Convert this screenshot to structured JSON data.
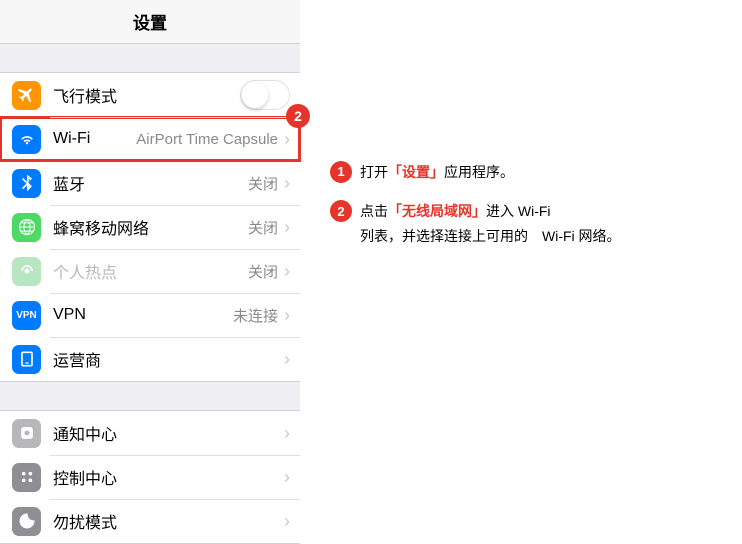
{
  "title": "设置",
  "rows": {
    "airplane": {
      "label": "飞行模式"
    },
    "wifi": {
      "label": "Wi-Fi",
      "value": "AirPort Time Capsule"
    },
    "bluetooth": {
      "label": "蓝牙",
      "value": "关闭"
    },
    "cellular": {
      "label": "蜂窝移动网络",
      "value": "关闭"
    },
    "hotspot": {
      "label": "个人热点",
      "value": "关闭"
    },
    "vpn": {
      "label": "VPN",
      "value": "未连接",
      "iconText": "VPN"
    },
    "carrier": {
      "label": "运营商"
    },
    "notifications": {
      "label": "通知中心"
    },
    "controlcenter": {
      "label": "控制中心"
    },
    "dnd": {
      "label": "勿扰模式"
    }
  },
  "badge2": "2",
  "instructions": {
    "step1": {
      "num": "1",
      "pre": "打开",
      "hl": "「设置」",
      "post": "应用程序。"
    },
    "step2": {
      "num": "2",
      "pre": "点击",
      "hl": "「无线局域网」",
      "post": "进入 Wi-Fi",
      "line2": "列表，并选择连接上可用的　Wi-Fi 网络。"
    }
  }
}
